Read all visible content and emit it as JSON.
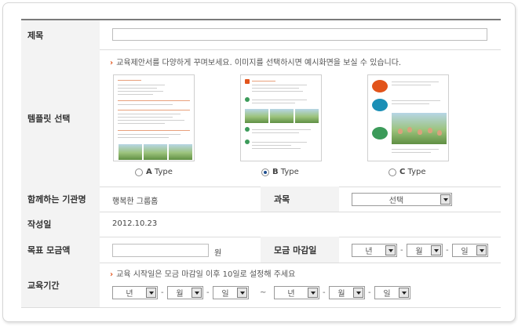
{
  "form": {
    "title_label": "제목",
    "title_value": "",
    "template_label": "템플릿 선택",
    "template_notice": "교육제안서를 다양하게 꾸며보세요. 이미지를 선택하시면 예시화면을 보실 수 있습니다.",
    "templates": [
      {
        "letter": "A",
        "suffix": " Type",
        "selected": false
      },
      {
        "letter": "B",
        "suffix": " Type",
        "selected": true
      },
      {
        "letter": "C",
        "suffix": " Type",
        "selected": false
      }
    ],
    "partner_label": "함께하는 기관명",
    "partner_value": "행복한 그룹홈",
    "subject_label": "과목",
    "subject_select": "선택",
    "date_label": "작성일",
    "date_value": "2012.10.23",
    "goal_label": "목표 모금액",
    "goal_value": "",
    "goal_unit": "원",
    "deadline_label": "모금 마감일",
    "deadline": {
      "year": "년",
      "month": "월",
      "day": "일"
    },
    "period_label": "교육기간",
    "period_notice": "교육 시작일은 모금 마감일 이후 10일로 설정해 주세요",
    "period_start": {
      "year": "년",
      "month": "월",
      "day": "일"
    },
    "period_sep": "~",
    "period_end": {
      "year": "년",
      "month": "월",
      "day": "일"
    },
    "date_sep": "-"
  },
  "colors": {
    "accent": "#e2541b",
    "header_bg": "#f3f3f3",
    "radio_selected": "#1f4e8f"
  }
}
